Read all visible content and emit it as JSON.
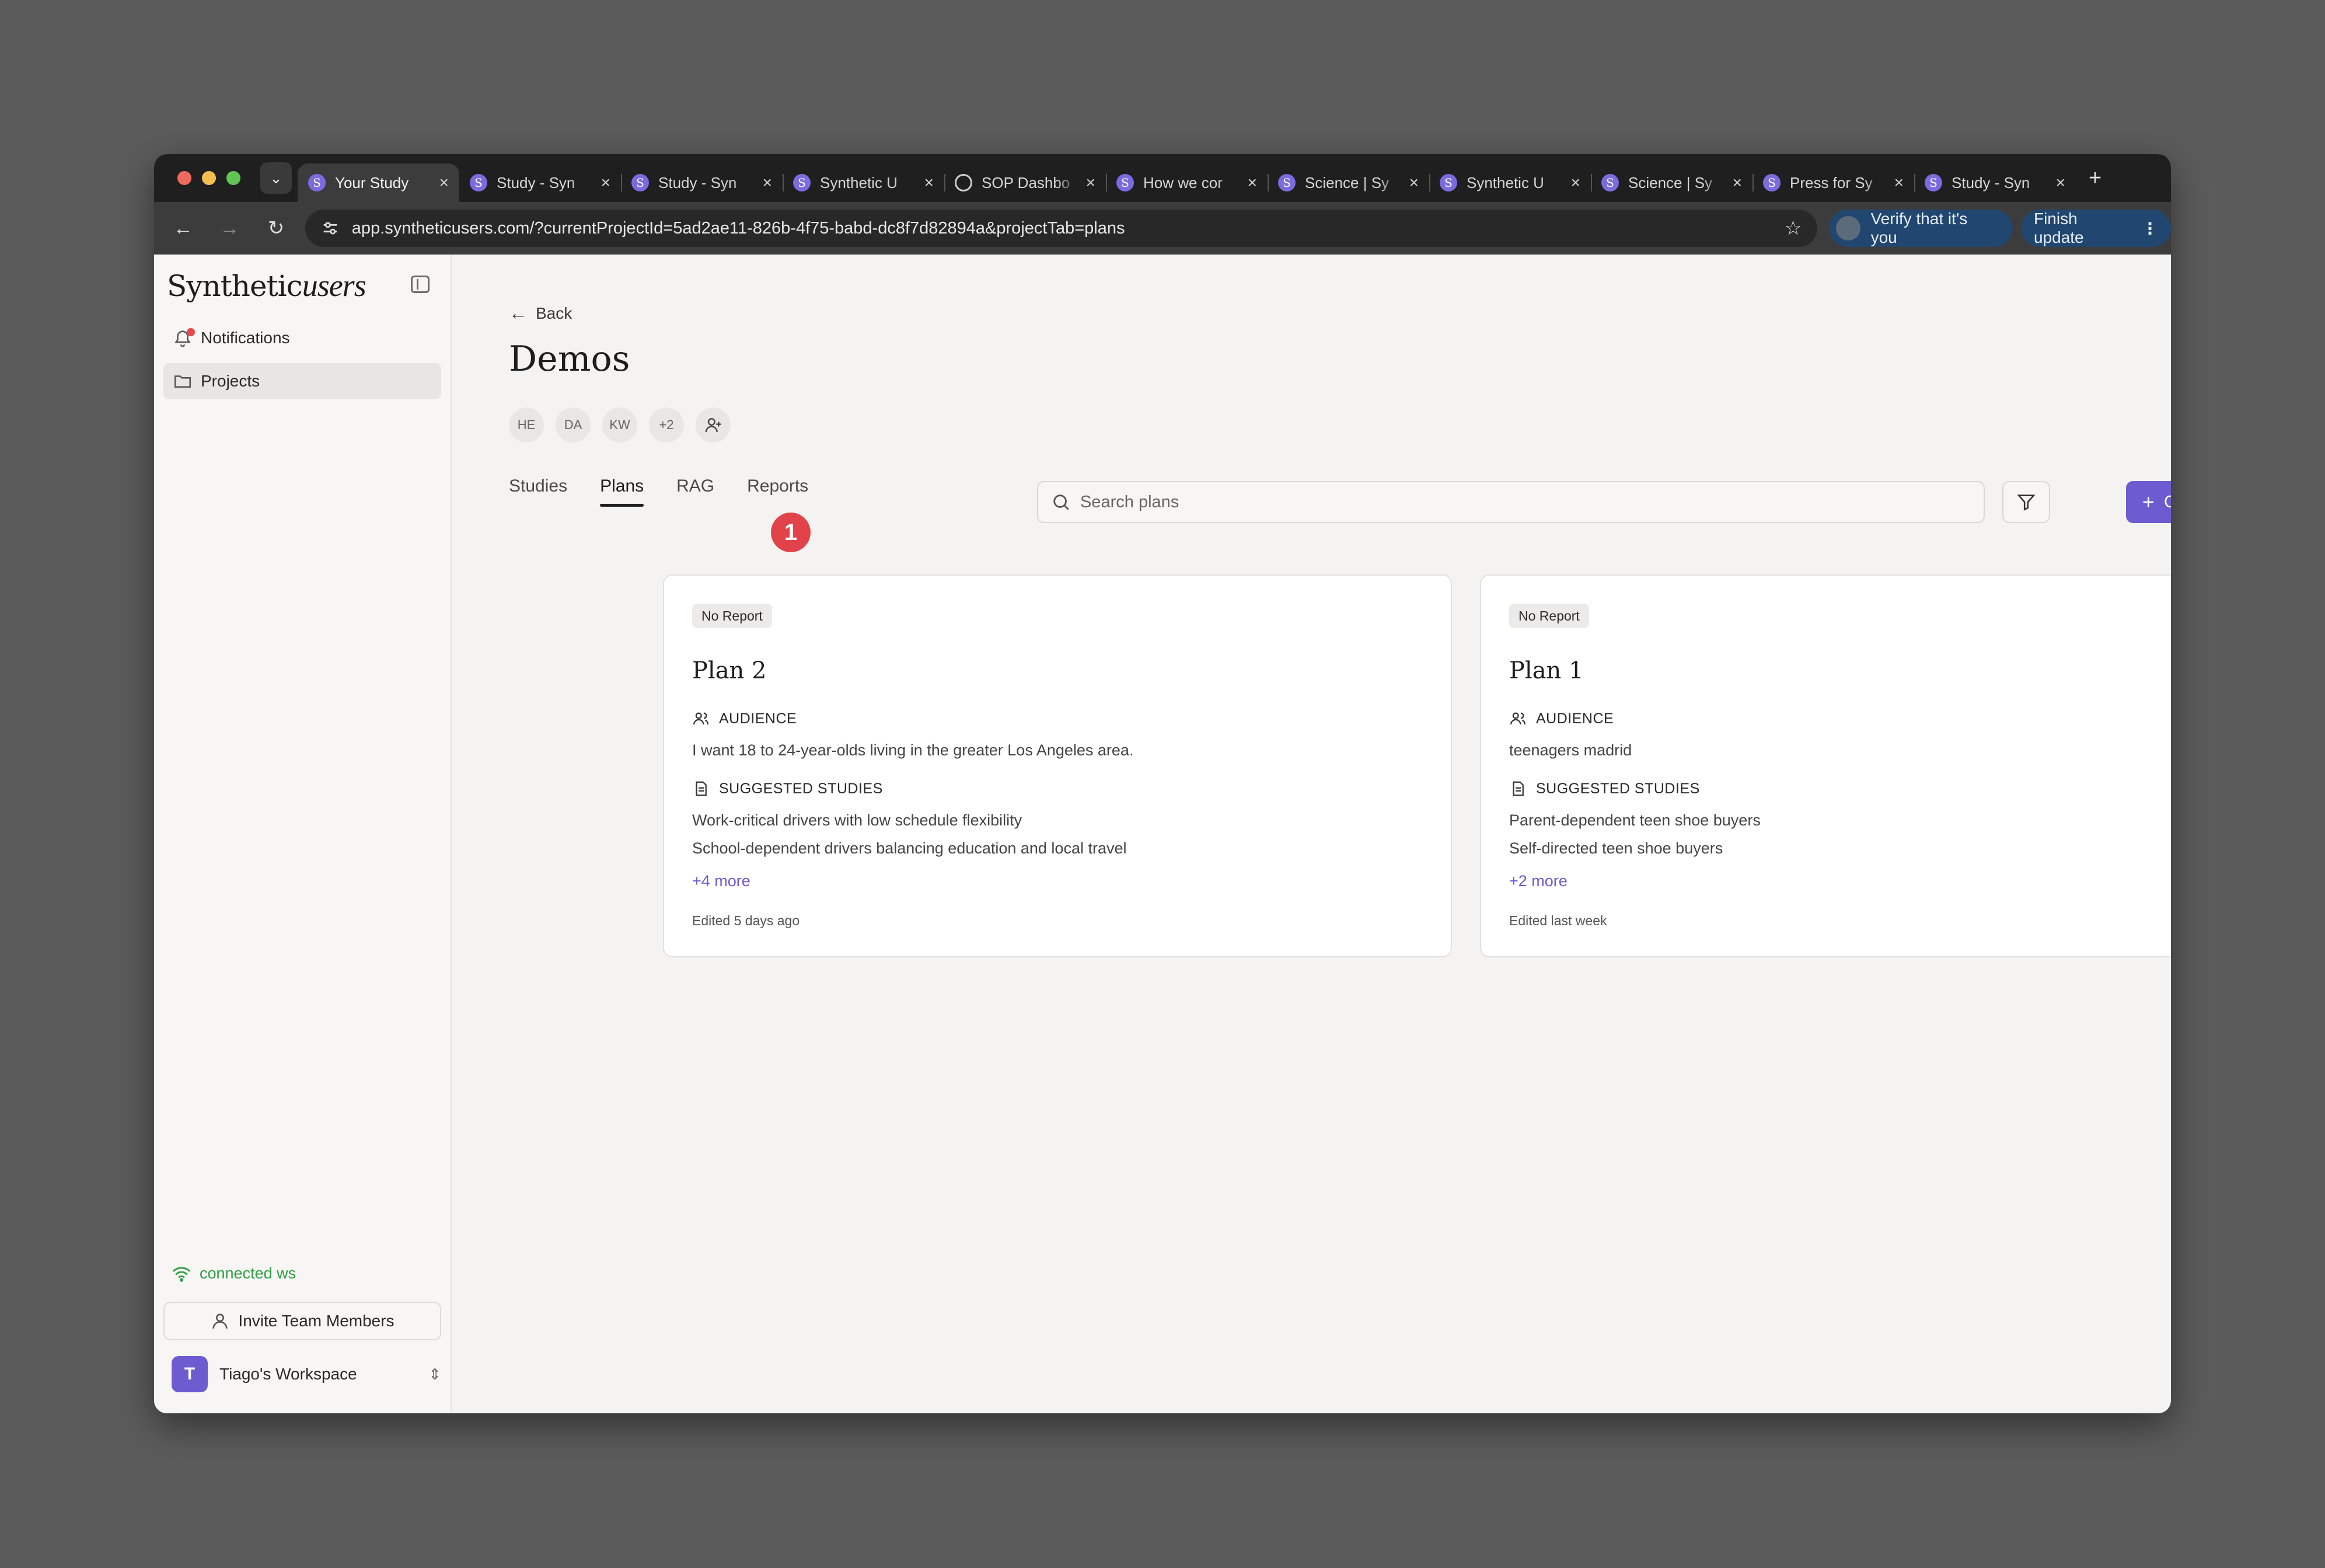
{
  "browser": {
    "tabs": [
      {
        "title": "Your Study",
        "icon": "s-favicon",
        "active": true
      },
      {
        "title": "Study - Syn",
        "icon": "s-favicon"
      },
      {
        "title": "Study - Syn",
        "icon": "s-favicon"
      },
      {
        "title": "Synthetic U",
        "icon": "s-favicon"
      },
      {
        "title": "SOP Dashbo",
        "icon": "globe-icon"
      },
      {
        "title": "How we cor",
        "icon": "s-favicon"
      },
      {
        "title": "Science | Sy",
        "icon": "s-favicon"
      },
      {
        "title": "Synthetic U",
        "icon": "s-favicon"
      },
      {
        "title": "Science | Sy",
        "icon": "s-favicon"
      },
      {
        "title": "Press for Sy",
        "icon": "s-favicon"
      },
      {
        "title": "Study - Syn",
        "icon": "s-favicon"
      }
    ],
    "favicon_letter": "S",
    "url": "app.syntheticusers.com/?currentProjectId=5ad2ae11-826b-4f75-babd-dc8f7d82894a&projectTab=plans",
    "verify_label": "Verify that it's you",
    "finish_label": "Finish update"
  },
  "sidebar": {
    "brand_plain": "Synthetic",
    "brand_script": "users",
    "items": [
      {
        "label": "Notifications",
        "icon": "bell-icon"
      },
      {
        "label": "Projects",
        "icon": "folder-icon",
        "selected": true
      }
    ],
    "status": "connected ws",
    "invite_label": "Invite Team Members",
    "workspace_initial": "T",
    "workspace_name": "Tiago's Workspace"
  },
  "main": {
    "back_label": "Back",
    "project_title": "Demos",
    "members": [
      "HE",
      "DA",
      "KW",
      "+2"
    ],
    "tabs": [
      "Studies",
      "Plans",
      "RAG",
      "Reports"
    ],
    "active_tab": "Plans",
    "step_badge": "1",
    "search_placeholder": "Search plans",
    "create_label": "Create Plan",
    "plans": [
      {
        "status": "No Report",
        "title": "Plan 2",
        "audience_label": "AUDIENCE",
        "audience": "I want 18 to 24-year-olds living in the greater Los Angeles area.",
        "studies_label": "SUGGESTED STUDIES",
        "studies": [
          "Work-critical drivers with low schedule flexibility",
          "School-dependent drivers balancing education and local travel"
        ],
        "more": "+4 more",
        "edited": "Edited 5 days ago"
      },
      {
        "status": "No Report",
        "title": "Plan 1",
        "audience_label": "AUDIENCE",
        "audience": "teenagers madrid",
        "studies_label": "SUGGESTED STUDIES",
        "studies": [
          "Parent-dependent teen shoe buyers",
          "Self-directed teen shoe buyers"
        ],
        "more": "+2 more",
        "edited": "Edited last week"
      }
    ]
  },
  "colors": {
    "accent": "#6d5bd0",
    "status_ok": "#2f9e44",
    "badge": "#e2434a"
  }
}
